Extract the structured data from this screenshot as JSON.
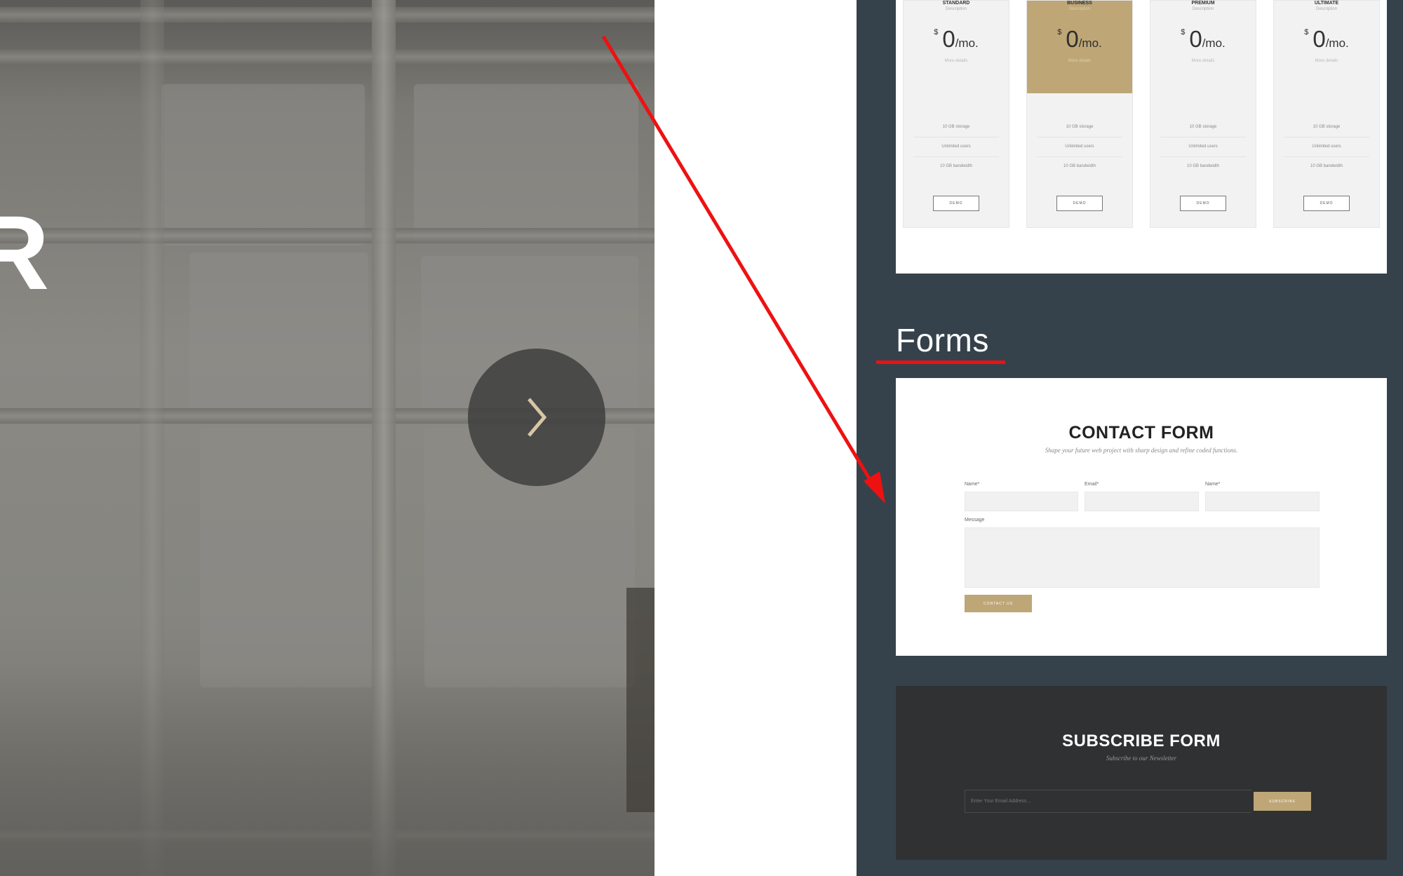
{
  "hero": {
    "partial_letter": "R",
    "next_icon": "chevron-right-icon"
  },
  "pricing": {
    "plans": [
      {
        "name": "STANDARD",
        "description": "Description",
        "currency": "$",
        "price": "0",
        "period": "/mo.",
        "more": "More details",
        "features": [
          "10 GB storage",
          "Unlimited users",
          "10 GB bandwidth"
        ],
        "button": "DEMO",
        "featured": false
      },
      {
        "name": "BUSINESS",
        "description": "Description",
        "currency": "$",
        "price": "0",
        "period": "/mo.",
        "more": "More details",
        "features": [
          "10 GB storage",
          "Unlimited users",
          "10 GB bandwidth"
        ],
        "button": "DEMO",
        "featured": true
      },
      {
        "name": "PREMIUM",
        "description": "Description",
        "currency": "$",
        "price": "0",
        "period": "/mo.",
        "more": "More details",
        "features": [
          "10 GB storage",
          "Unlimited users",
          "10 GB bandwidth"
        ],
        "button": "DEMO",
        "featured": false
      },
      {
        "name": "ULTIMATE",
        "description": "Description",
        "currency": "$",
        "price": "0",
        "period": "/mo.",
        "more": "More details",
        "features": [
          "10 GB storage",
          "Unlimited users",
          "10 GB bandwidth"
        ],
        "button": "DEMO",
        "featured": false
      }
    ]
  },
  "forms_section": {
    "title": "Forms"
  },
  "contact_form": {
    "title": "CONTACT FORM",
    "subtitle": "Shape your future web project with sharp design and refine coded functions.",
    "field1_label": "Name*",
    "field2_label": "Email*",
    "field3_label": "Name*",
    "message_label": "Message",
    "button": "CONTACT US"
  },
  "subscribe_form": {
    "title": "SUBSCRIBE FORM",
    "subtitle": "Subscribe to our Newsletter",
    "placeholder": "Enter Your Email Address...",
    "button": "SUBSCRIBE"
  },
  "colors": {
    "accent_gold": "#bea677",
    "panel_bg": "#35424b",
    "annotation_red": "#ee1111"
  }
}
